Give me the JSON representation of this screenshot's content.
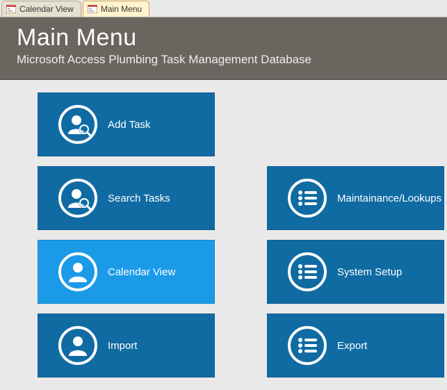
{
  "tabs": [
    {
      "label": "Calendar View",
      "active": false
    },
    {
      "label": "Main Menu",
      "active": true
    }
  ],
  "header": {
    "title": "Main Menu",
    "subtitle": "Microsoft Access Plumbing Task Management Database"
  },
  "tiles": {
    "addTask": "Add Task",
    "searchTasks": "Search Tasks",
    "calendarView": "Calendar View",
    "import": "Import",
    "maintenance": "Maintainance/Lookups",
    "systemSetup": "System Setup",
    "export": "Export"
  }
}
